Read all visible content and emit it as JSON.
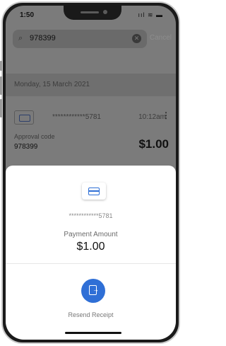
{
  "status_bar": {
    "time": "1:50",
    "icons": "ııl ≋ ▬"
  },
  "search": {
    "query": "978399",
    "cancel_label": "Cancel"
  },
  "date_header": "Monday, 15 March 2021",
  "transaction": {
    "card_number": "************5781",
    "time": "10:12am",
    "approval_label": "Approval code",
    "approval_code": "978399",
    "amount": "$1.00"
  },
  "sheet": {
    "card_number": "************5781",
    "payment_label": "Payment Amount",
    "amount": "$1.00",
    "resend_label": "Resend Receipt"
  },
  "colors": {
    "accent": "#2f6fd6"
  }
}
